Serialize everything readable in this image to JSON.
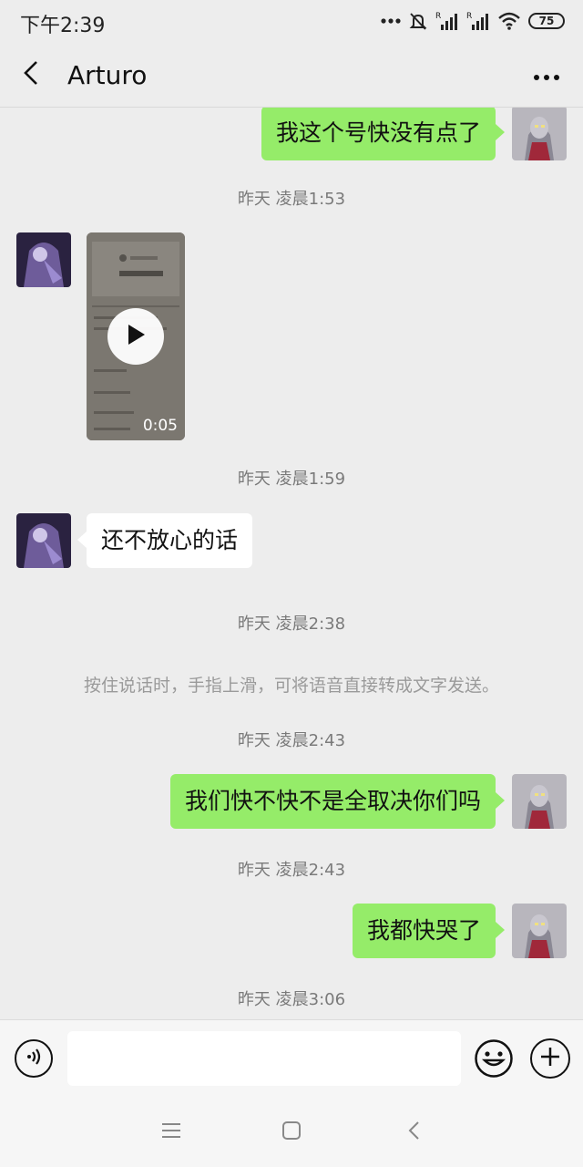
{
  "status_bar": {
    "time": "下午2:39",
    "battery": "75",
    "icons": [
      "more-dots-icon",
      "mute-bell-icon",
      "signal-roaming-icon",
      "signal-roaming-icon",
      "wifi-icon",
      "battery-icon"
    ]
  },
  "header": {
    "title": "Arturo",
    "back_icon": "chevron-left-icon",
    "more_icon": "more-dots-icon"
  },
  "messages": [
    {
      "type": "text",
      "direction": "sent",
      "text": "我这个号快没有点了"
    },
    {
      "type": "timestamp",
      "text": "昨天 凌晨1:53"
    },
    {
      "type": "video",
      "direction": "received",
      "duration": "0:05"
    },
    {
      "type": "timestamp",
      "text": "昨天 凌晨1:59"
    },
    {
      "type": "text",
      "direction": "received",
      "text": "还不放心的话"
    },
    {
      "type": "timestamp",
      "text": "昨天 凌晨2:38"
    },
    {
      "type": "system",
      "text": "按住说话时，手指上滑，可将语音直接转成文字发送。"
    },
    {
      "type": "timestamp",
      "text": "昨天 凌晨2:43"
    },
    {
      "type": "text",
      "direction": "sent",
      "text": "我们快不快不是全取决你们吗"
    },
    {
      "type": "timestamp",
      "text": "昨天 凌晨2:43"
    },
    {
      "type": "text",
      "direction": "sent",
      "text": "我都快哭了"
    },
    {
      "type": "timestamp",
      "text": "昨天 凌晨3:06"
    }
  ],
  "input_bar": {
    "text_value": "",
    "icons": [
      "voice-icon",
      "emoji-icon",
      "plus-icon"
    ]
  },
  "nav_bar": {
    "icons": [
      "menu-icon",
      "home-icon",
      "back-icon"
    ]
  },
  "colors": {
    "background": "#ededed",
    "sent_bubble": "#95ec69",
    "received_bubble": "#ffffff",
    "timestamp_text": "#7a7a7a"
  }
}
